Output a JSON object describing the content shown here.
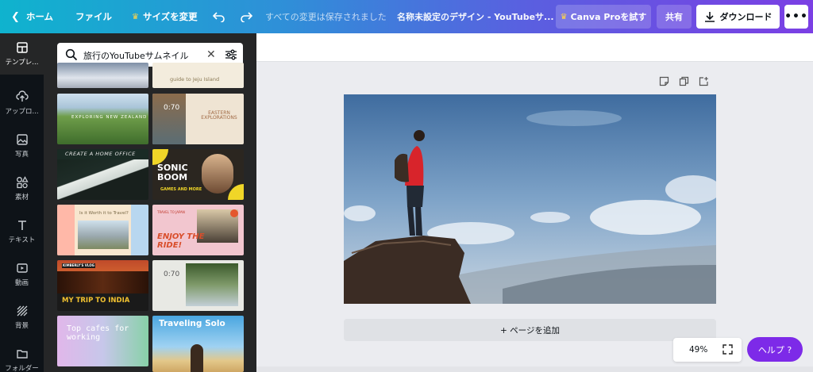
{
  "topbar": {
    "home_label": "ホーム",
    "file_label": "ファイル",
    "resize_label": "サイズを変更",
    "saved_status": "すべての変更は保存されました",
    "design_title": "名称未設定のデザイン - YouTubeサ...",
    "pro_label": "Canva Proを試す",
    "share_label": "共有",
    "download_label": "ダウンロード",
    "more_label": "•••"
  },
  "leftnav": {
    "items": [
      {
        "label": "テンプレ...",
        "icon": "template-icon"
      },
      {
        "label": "アップロ...",
        "icon": "upload-icon"
      },
      {
        "label": "写真",
        "icon": "photo-icon"
      },
      {
        "label": "素材",
        "icon": "elements-icon"
      },
      {
        "label": "テキスト",
        "icon": "text-icon"
      },
      {
        "label": "動画",
        "icon": "video-icon"
      },
      {
        "label": "背景",
        "icon": "background-icon"
      },
      {
        "label": "フォルダー",
        "icon": "folder-icon"
      }
    ]
  },
  "search": {
    "value": "旅行のYouTubeサムネイル"
  },
  "templates": {
    "t2": "guide to Jeju Island",
    "t3": "EXPLORING NEW ZEALAND",
    "t4_time": "0:70",
    "t4": "EASTERN EXPLORATIONS",
    "t5": "CREATE A HOME OFFICE",
    "t6a": "SONIC BOOM",
    "t6b": "GAMES AND MORE",
    "t7": "Is it Worth it to Travel?",
    "t8a": "TRAVEL TO JAPAN",
    "t8b": "ENJOY THE RIDE!",
    "t9a": "KIMBERLY'S VLOG",
    "t9b": "MY TRIP TO INDIA",
    "t10_time": "0:70",
    "t11": "Top cafes for working",
    "t12": "Traveling Solo"
  },
  "canvas": {
    "add_page_label": "+ ページを追加",
    "zoom": "49%",
    "help_label": "ヘルプ ?"
  }
}
